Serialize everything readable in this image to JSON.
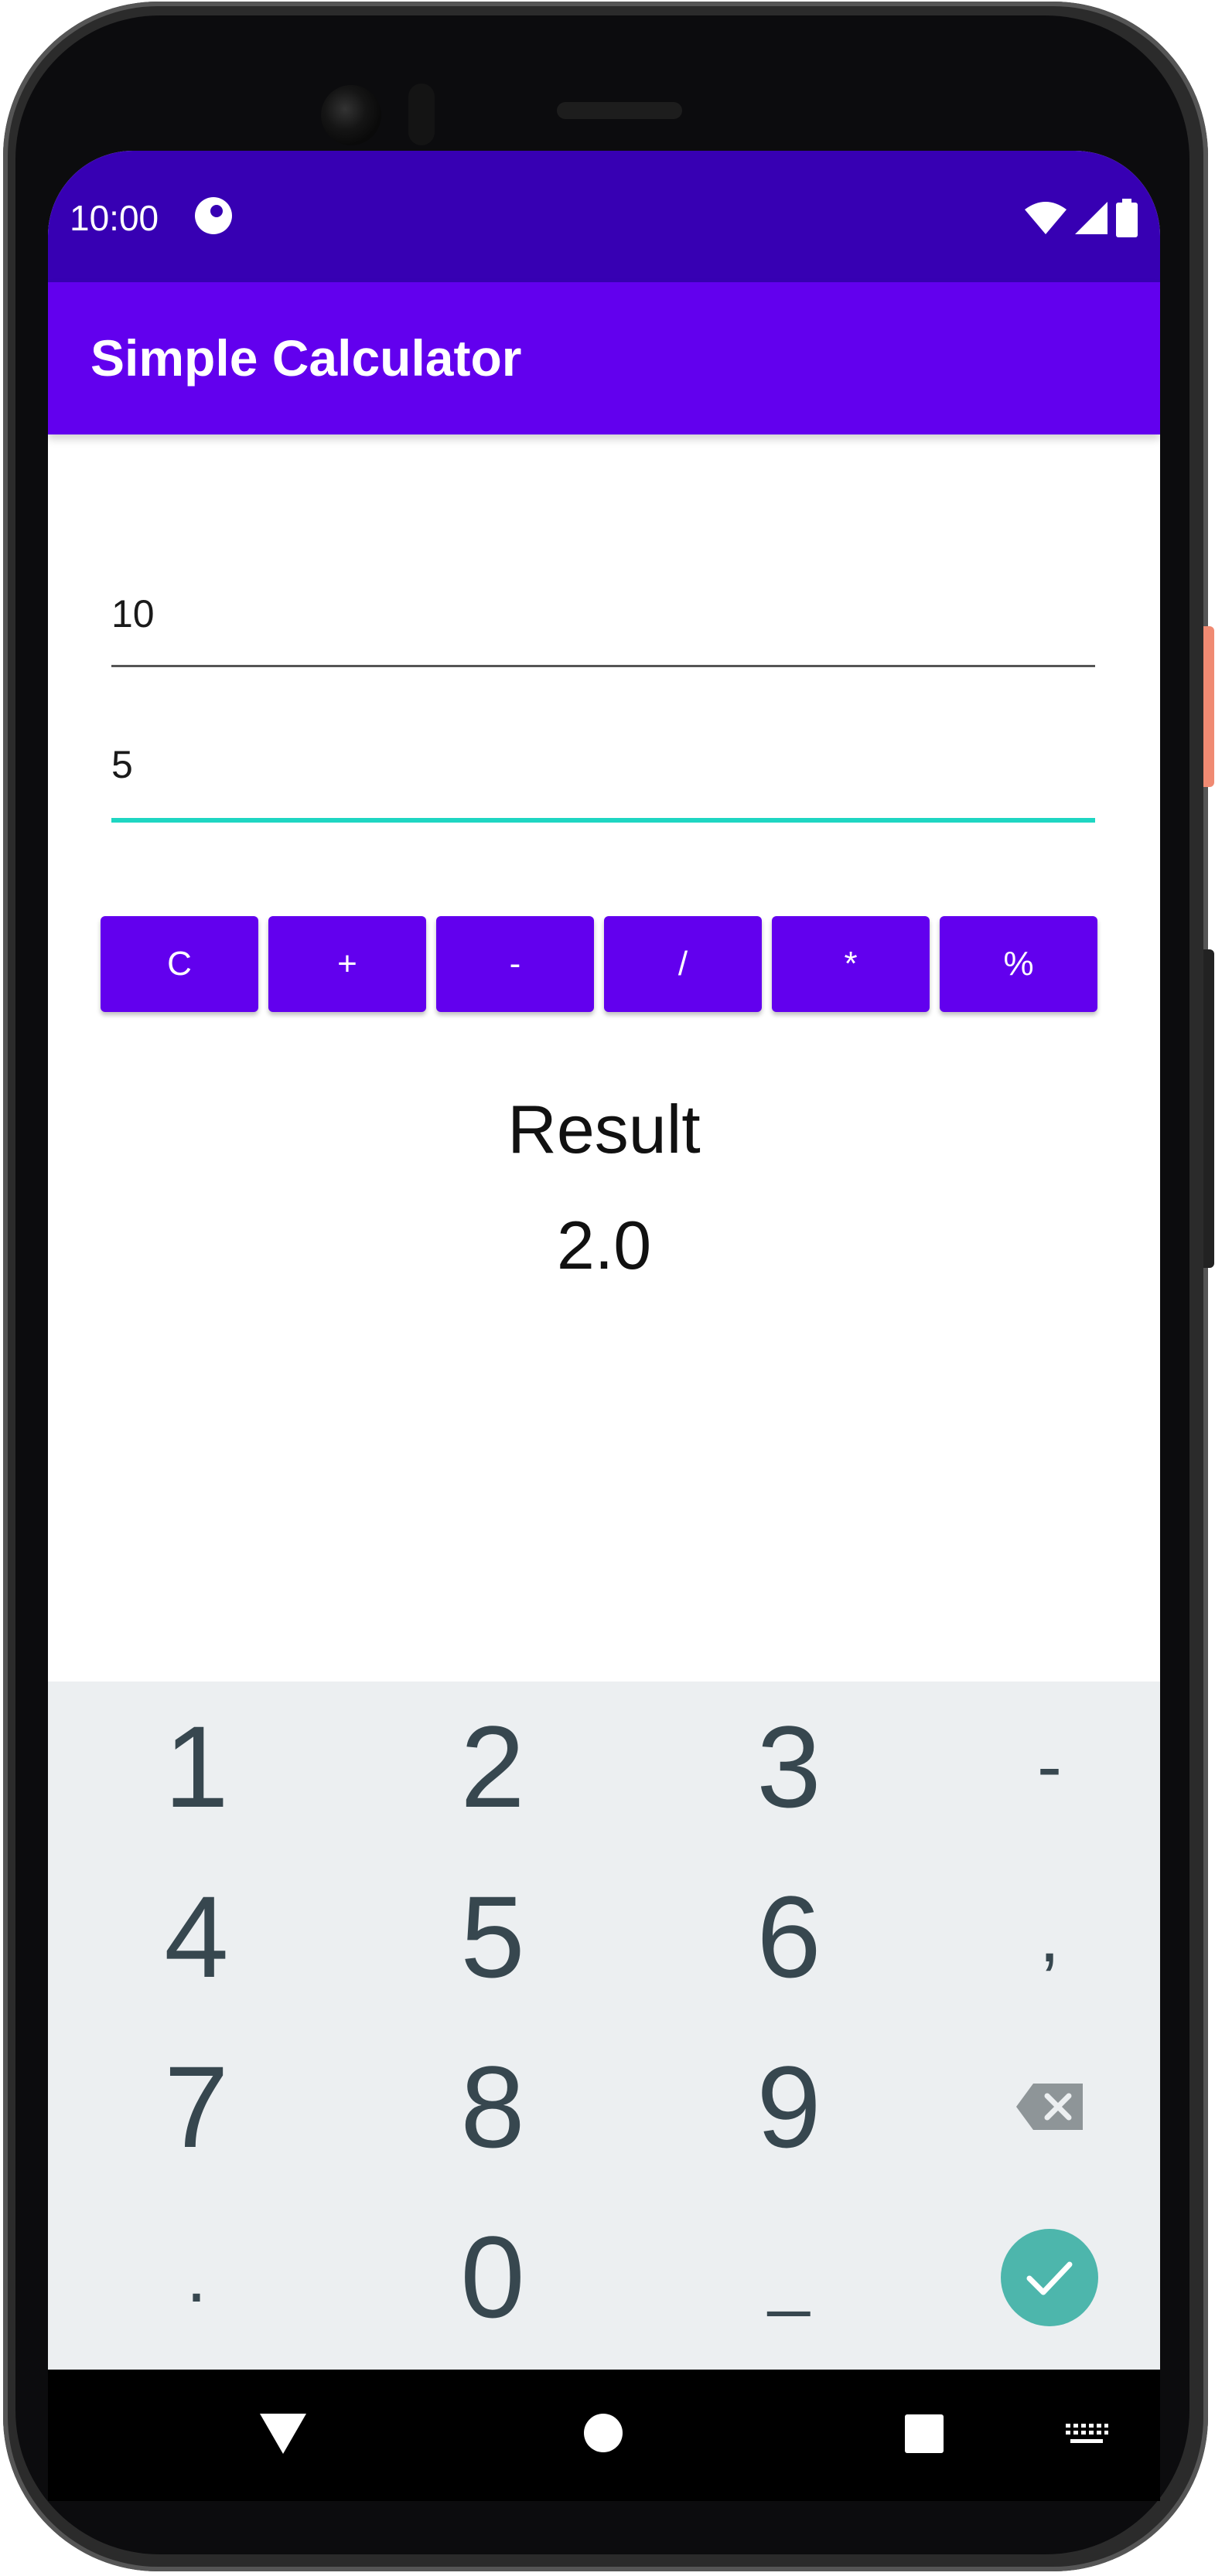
{
  "status_bar": {
    "time": "10:00",
    "icons": [
      "app-notification-icon",
      "wifi-icon",
      "signal-icon",
      "battery-icon"
    ]
  },
  "app_bar": {
    "title": "Simple Calculator",
    "color": "#6200ee",
    "status_color": "#3700b3"
  },
  "inputs": {
    "first_value": "10",
    "second_value": "5",
    "focus_color": "#1ed6c2"
  },
  "operations": [
    {
      "label": "C"
    },
    {
      "label": "+"
    },
    {
      "label": "-"
    },
    {
      "label": "/"
    },
    {
      "label": "*"
    },
    {
      "label": "%"
    }
  ],
  "result": {
    "label": "Result",
    "value": "2.0"
  },
  "keyboard": {
    "rows": [
      [
        "1",
        "2",
        "3",
        "-"
      ],
      [
        "4",
        "5",
        "6",
        ","
      ],
      [
        "7",
        "8",
        "9",
        "backspace-icon"
      ],
      [
        ".",
        "0",
        "_",
        "enter-check-icon"
      ]
    ],
    "enter_color": "#4db6ac"
  },
  "navigation": {
    "icons": [
      "back-icon",
      "home-icon",
      "recents-icon",
      "keyboard-switch-icon"
    ]
  }
}
